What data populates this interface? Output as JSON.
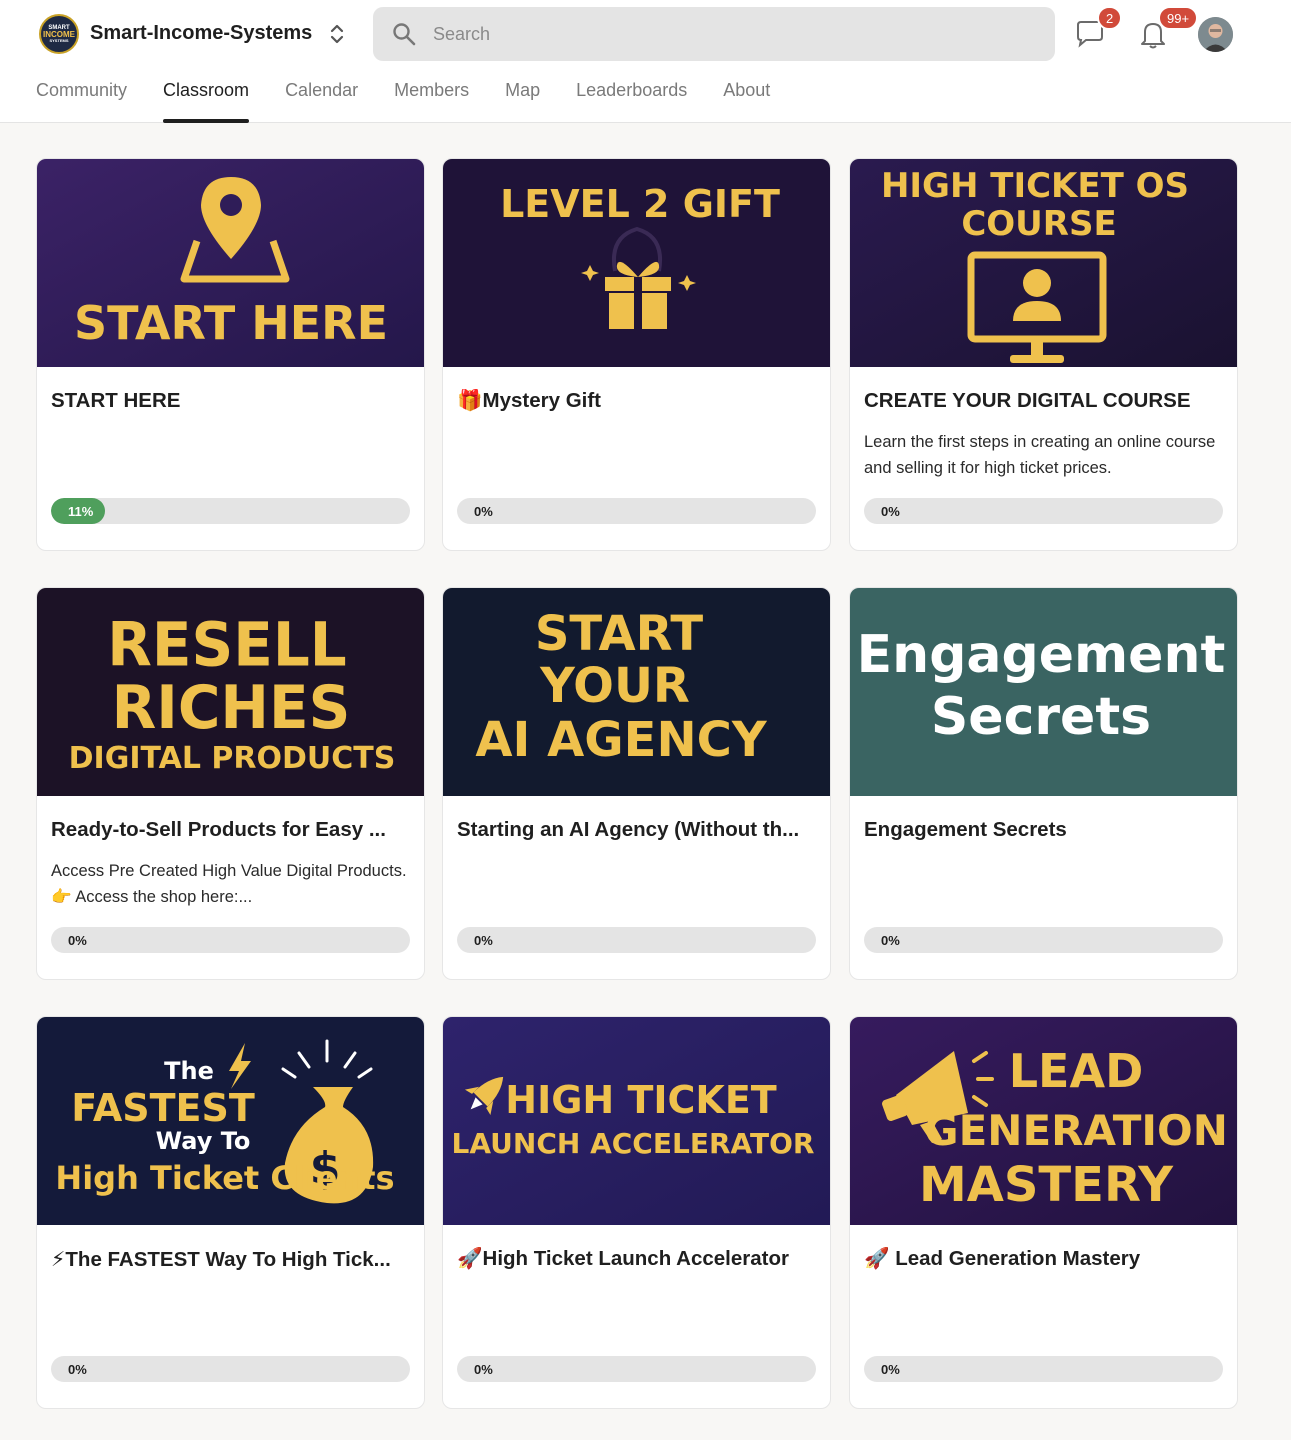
{
  "header": {
    "logo_text": [
      "SMART",
      "INCOME",
      "SYSTEMS"
    ],
    "community_name": "Smart-Income-Systems",
    "search_placeholder": "Search",
    "chat_badge": "2",
    "notifications_badge": "99+"
  },
  "nav": {
    "tabs": [
      {
        "label": "Community",
        "active": false
      },
      {
        "label": "Classroom",
        "active": true
      },
      {
        "label": "Calendar",
        "active": false
      },
      {
        "label": "Members",
        "active": false
      },
      {
        "label": "Map",
        "active": false
      },
      {
        "label": "Leaderboards",
        "active": false
      },
      {
        "label": "About",
        "active": false
      }
    ]
  },
  "courses": [
    {
      "thumb_text": [
        "START HERE"
      ],
      "title": "START HERE",
      "description": "",
      "progress": 11,
      "progress_label": "11%"
    },
    {
      "thumb_text": [
        "LEVEL 2 GIFT"
      ],
      "title": "🎁Mystery Gift",
      "description": "",
      "progress": 0,
      "progress_label": "0%"
    },
    {
      "thumb_text": [
        "HIGH TICKET OS",
        "COURSE"
      ],
      "title": "CREATE YOUR DIGITAL COURSE",
      "description": "Learn the first steps in creating an online course and selling it for high ticket prices.",
      "progress": 0,
      "progress_label": "0%"
    },
    {
      "thumb_text": [
        "RESELL",
        "RICHES",
        "DIGITAL PRODUCTS"
      ],
      "title": "Ready-to-Sell Products for Easy ...",
      "description": "Access Pre Created High Value Digital Products. 👉 Access the shop here:...",
      "progress": 0,
      "progress_label": "0%"
    },
    {
      "thumb_text": [
        "START",
        "YOUR",
        "AI AGENCY"
      ],
      "title": "Starting an AI Agency (Without th...",
      "description": "",
      "progress": 0,
      "progress_label": "0%"
    },
    {
      "thumb_text": [
        "Engagement",
        "Secrets"
      ],
      "title": "Engagement Secrets",
      "description": "",
      "progress": 0,
      "progress_label": "0%"
    },
    {
      "thumb_text": [
        "The",
        "FASTEST",
        "Way To",
        "High Ticket Clients"
      ],
      "title": "⚡The FASTEST Way To High Tick...",
      "description": "",
      "progress": 0,
      "progress_label": "0%"
    },
    {
      "thumb_text": [
        "HIGH TICKET",
        "LAUNCH ACCELERATOR"
      ],
      "title": "🚀High Ticket Launch Accelerator",
      "description": "",
      "progress": 0,
      "progress_label": "0%"
    },
    {
      "thumb_text": [
        "LEAD",
        "GENERATION",
        "MASTERY"
      ],
      "title": "🚀 Lead Generation Mastery",
      "description": "",
      "progress": 0,
      "progress_label": "0%"
    }
  ],
  "colors": {
    "accent_gold": "#efc14d",
    "progress_green": "#4f9f5c",
    "badge_red": "#d14a3a"
  }
}
